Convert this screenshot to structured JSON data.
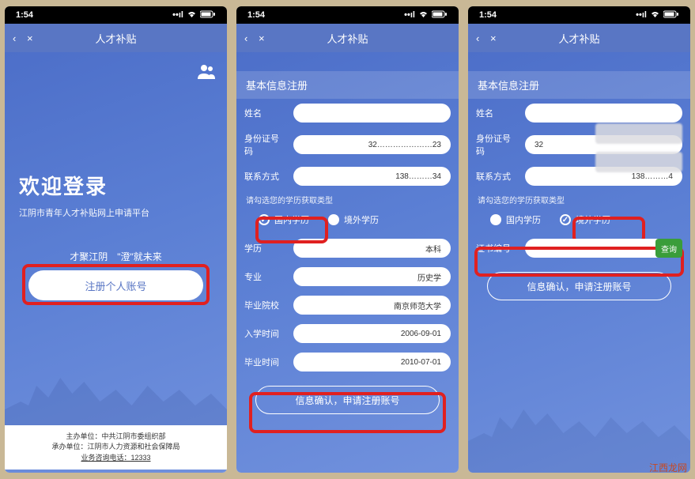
{
  "status": {
    "time": "1:54",
    "signal": "•ıll",
    "wifi": "wifi",
    "battery": "batt"
  },
  "nav": {
    "back": "‹",
    "close": "×",
    "title": "人才补贴"
  },
  "screen1": {
    "welcome_title": "欢迎登录",
    "welcome_sub": "江阴市青年人才补贴网上申请平台",
    "tagline": "才聚江阴　\"澄\"就未来",
    "register_btn": "注册个人账号",
    "footer_sponsor_label": "主办单位：",
    "footer_sponsor": "中共江阴市委组织部",
    "footer_undertake_label": "承办单位：",
    "footer_undertake": "江阴市人力资源和社会保障局",
    "footer_phone_label": "业务咨询电话：",
    "footer_phone": "12333"
  },
  "screen2": {
    "section_title": "基本信息注册",
    "name_label": "姓名",
    "id_label": "身份证号码",
    "id_value": "32…………………23",
    "phone_label": "联系方式",
    "phone_value": "138………34",
    "edu_hint": "请勾选您的学历获取类型",
    "radio_domestic": "国内学历",
    "radio_abroad": "境外学历",
    "degree_label": "学历",
    "degree_value": "本科",
    "major_label": "专业",
    "major_value": "历史学",
    "school_label": "毕业院校",
    "school_value": "南京师范大学",
    "enroll_label": "入学时间",
    "enroll_value": "2006-09-01",
    "grad_label": "毕业时间",
    "grad_value": "2010-07-01",
    "confirm_btn": "信息确认，申请注册账号"
  },
  "screen3": {
    "section_title": "基本信息注册",
    "name_label": "姓名",
    "id_label": "身份证号码",
    "id_value": "32",
    "phone_label": "联系方式",
    "phone_value": "138………4",
    "edu_hint": "请勾选您的学历获取类型",
    "radio_domestic": "国内学历",
    "radio_abroad": "境外学历",
    "cert_label": "证书编号",
    "query_btn": "查询",
    "confirm_btn": "信息确认，申请注册账号"
  },
  "watermark": "江西龙网"
}
